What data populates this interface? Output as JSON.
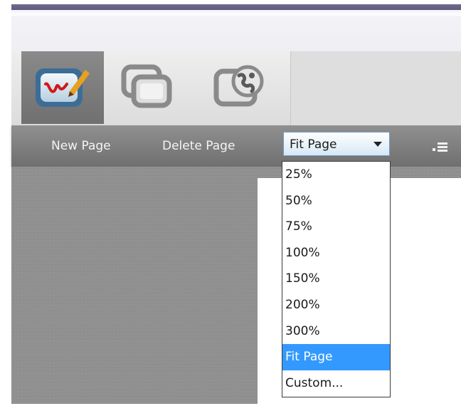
{
  "toolbar": {
    "tools": [
      {
        "icon": "pen-whiteboard-icon",
        "active": true
      },
      {
        "icon": "overlapping-windows-icon",
        "active": false
      },
      {
        "icon": "globe-window-icon",
        "active": false
      }
    ]
  },
  "commands": {
    "new_page": "New Page",
    "delete_page": "Delete Page",
    "zoom_select": {
      "value": "Fit Page"
    },
    "menu_icon": "list-menu-icon"
  },
  "dropdown": {
    "options": [
      "25%",
      "50%",
      "75%",
      "100%",
      "150%",
      "200%",
      "300%",
      "Fit Page",
      "Custom..."
    ],
    "selected_index": 7
  },
  "colors": {
    "selection": "#3399ff",
    "command_bar": "#7f7f7f",
    "workspace": "#8f8f8f"
  }
}
